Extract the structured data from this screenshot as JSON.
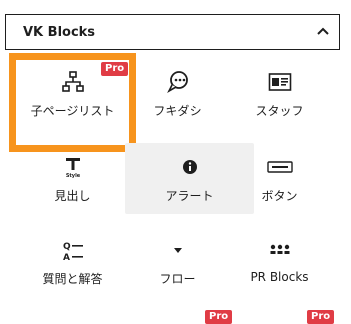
{
  "panel": {
    "title": "VK Blocks"
  },
  "blocks": [
    {
      "label": "子ページリスト",
      "icon": "sitemap-icon",
      "pro": true
    },
    {
      "label": "フキダシ",
      "icon": "speech-bubble-icon",
      "pro": false
    },
    {
      "label": "スタッフ",
      "icon": "staff-card-icon",
      "pro": false
    },
    {
      "label": "見出し",
      "icon": "heading-icon",
      "pro": false
    },
    {
      "label": "アラート",
      "icon": "alert-info-icon",
      "pro": false
    },
    {
      "label": "ボタン",
      "icon": "button-icon",
      "pro": false
    },
    {
      "label": "質問と解答",
      "icon": "faq-icon",
      "pro": false
    },
    {
      "label": "フロー",
      "icon": "flow-arrow-icon",
      "pro": false
    },
    {
      "label": "PR Blocks",
      "icon": "pr-blocks-icon",
      "pro": false
    }
  ],
  "badge_text": "Pro",
  "colors": {
    "highlight": "#f7941d",
    "pro_badge": "#e03c45",
    "active_bg": "#f0f0f0"
  }
}
